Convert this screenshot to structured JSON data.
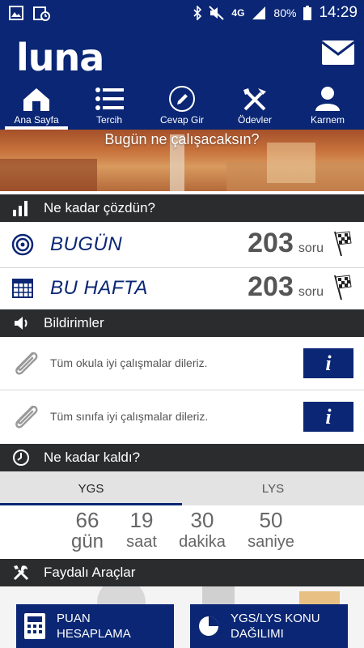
{
  "status_bar": {
    "network": "4G",
    "battery": "80%",
    "time": "14:29"
  },
  "app": {
    "logo": "luna"
  },
  "nav": {
    "tabs": [
      {
        "label": "Ana Sayfa",
        "icon": "home-icon",
        "active": true
      },
      {
        "label": "Tercih",
        "icon": "list-icon",
        "active": false
      },
      {
        "label": "Cevap Gir",
        "icon": "pencil-icon",
        "active": false
      },
      {
        "label": "Ödevler",
        "icon": "tools-icon",
        "active": false
      },
      {
        "label": "Karnem",
        "icon": "person-icon",
        "active": false
      }
    ]
  },
  "banner": {
    "text": "Bugün ne çalışacaksın?"
  },
  "solved": {
    "header": "Ne kadar çözdün?",
    "today": {
      "label": "BUGÜN",
      "count": "203",
      "unit": "soru"
    },
    "week": {
      "label": "BU HAFTA",
      "count": "203",
      "unit": "soru"
    }
  },
  "notifications": {
    "header": "Bildirimler",
    "items": [
      {
        "text": "Tüm okula iyi çalışmalar dileriz.",
        "button": "i"
      },
      {
        "text": "Tüm sınıfa iyi çalışmalar dileriz.",
        "button": "i"
      }
    ]
  },
  "countdown": {
    "header": "Ne kadar kaldı?",
    "tabs": [
      {
        "label": "YGS",
        "active": true
      },
      {
        "label": "LYS",
        "active": false
      }
    ],
    "values": [
      {
        "num": "66",
        "unit": "gün"
      },
      {
        "num": "19",
        "unit": "saat"
      },
      {
        "num": "30",
        "unit": "dakika"
      },
      {
        "num": "50",
        "unit": "saniye"
      }
    ]
  },
  "tools": {
    "header": "Faydalı Araçlar",
    "buttons": [
      {
        "line1": "PUAN",
        "line2": "HESAPLAMA",
        "icon": "calculator-icon"
      },
      {
        "line1": "YGS/LYS KONU",
        "line2": "DAĞILIMI",
        "icon": "pie-chart-icon"
      }
    ]
  },
  "colors": {
    "primary": "#0a2674",
    "header_bg": "#2b2c2e",
    "text_gray": "#555555"
  }
}
